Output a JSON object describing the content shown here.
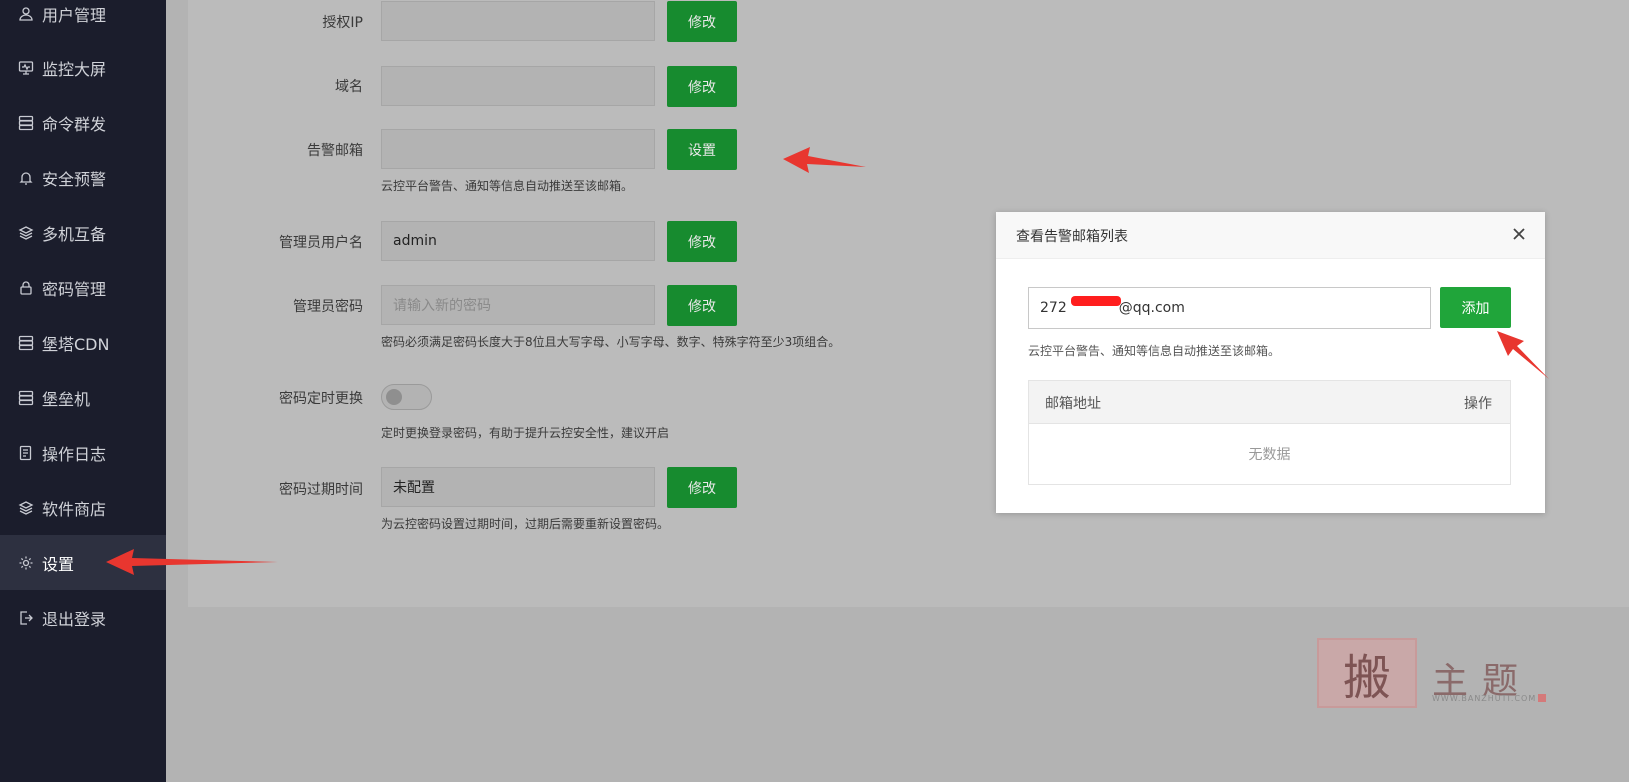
{
  "sidebar": {
    "items": [
      {
        "label": "用户管理",
        "icon": "user-icon"
      },
      {
        "label": "监控大屏",
        "icon": "monitor-icon"
      },
      {
        "label": "命令群发",
        "icon": "server-icon"
      },
      {
        "label": "安全预警",
        "icon": "bell-icon"
      },
      {
        "label": "多机互备",
        "icon": "layers-icon"
      },
      {
        "label": "密码管理",
        "icon": "lock-icon"
      },
      {
        "label": "堡塔CDN",
        "icon": "server-icon"
      },
      {
        "label": "堡垒机",
        "icon": "server-icon"
      },
      {
        "label": "操作日志",
        "icon": "log-icon"
      },
      {
        "label": "软件商店",
        "icon": "layers-icon"
      },
      {
        "label": "设置",
        "icon": "gear-icon",
        "active": true
      },
      {
        "label": "退出登录",
        "icon": "logout-icon"
      }
    ]
  },
  "settings": {
    "auth_ip": {
      "label": "授权IP",
      "value": "",
      "button": "修改"
    },
    "domain": {
      "label": "域名",
      "value": "",
      "button": "修改"
    },
    "alert_email": {
      "label": "告警邮箱",
      "value": "",
      "button": "设置",
      "hint": "云控平台警告、通知等信息自动推送至该邮箱。"
    },
    "admin_username": {
      "label": "管理员用户名",
      "value": "admin",
      "button": "修改"
    },
    "admin_password": {
      "label": "管理员密码",
      "placeholder": "请输入新的密码",
      "button": "修改",
      "hint": "密码必须满足密码长度大于8位且大写字母、小写字母、数字、特殊字符至少3项组合。"
    },
    "password_rotation": {
      "label": "密码定时更换",
      "enabled": false,
      "hint": "定时更换登录密码，有助于提升云控安全性，建议开启"
    },
    "password_expiry": {
      "label": "密码过期时间",
      "value": "未配置",
      "button": "修改",
      "hint": "为云控密码设置过期时间，过期后需要重新设置密码。"
    }
  },
  "modal": {
    "title": "查看告警邮箱列表",
    "close_icon": "close-icon",
    "email_prefix": "272",
    "email_suffix": "@qq.com",
    "add_button": "添加",
    "hint": "云控平台警告、通知等信息自动推送至该邮箱。",
    "table": {
      "columns": [
        "邮箱地址",
        "操作"
      ],
      "empty_text": "无数据"
    }
  },
  "watermark": {
    "seal_char": "搬",
    "text": "主题",
    "url": "WWW.BANZHUTI.COM"
  },
  "colors": {
    "sidebar_bg": "#1b1d2c",
    "button_green": "#20a53a",
    "annotation_red": "#e8362f"
  }
}
